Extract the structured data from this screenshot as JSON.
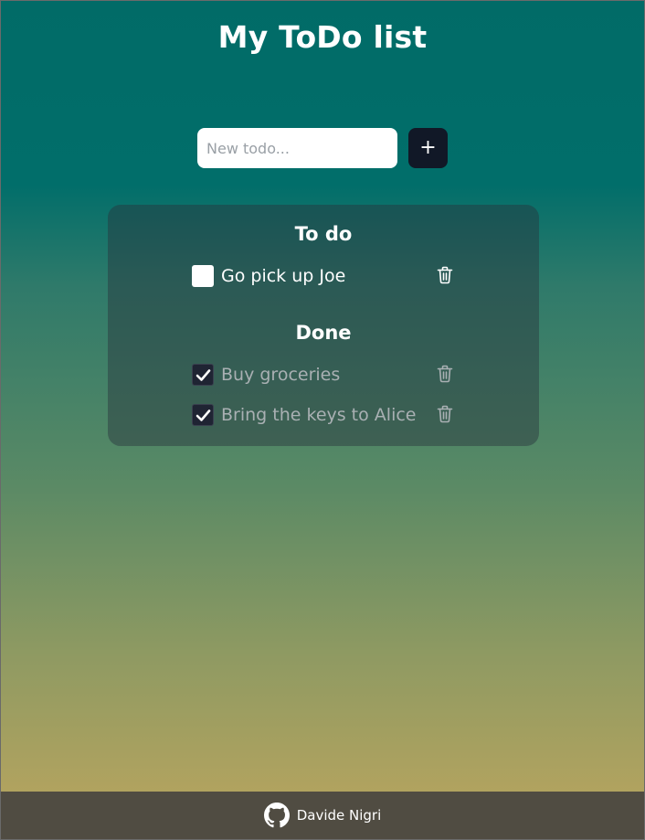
{
  "header": {
    "title": "My ToDo list"
  },
  "new_todo": {
    "placeholder": "New todo...",
    "value": "",
    "add_label": "+"
  },
  "sections": {
    "todo": {
      "title": "To do",
      "items": [
        {
          "label": "Go pick up Joe",
          "checked": false
        }
      ]
    },
    "done": {
      "title": "Done",
      "items": [
        {
          "label": "Buy groceries",
          "checked": true
        },
        {
          "label": "Bring the keys to Alice",
          "checked": true
        }
      ]
    }
  },
  "footer": {
    "author": "Davide Nigri",
    "icon": "github-icon"
  },
  "colors": {
    "gradient_top": "#016b67",
    "gradient_bottom": "#bda65e",
    "add_button": "#111827",
    "footer_bg": "#504c42",
    "done_text": "#a9b0b3"
  }
}
